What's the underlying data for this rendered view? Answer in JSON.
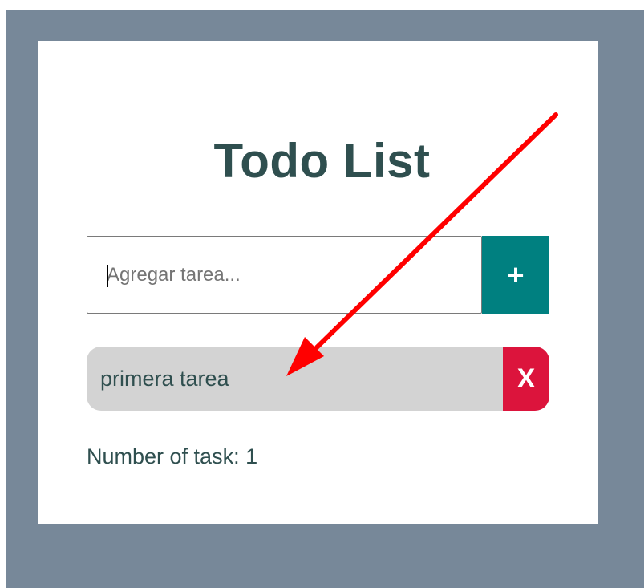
{
  "app": {
    "title": "Todo List"
  },
  "input": {
    "value": "",
    "placeholder": "Agregar tarea..."
  },
  "add_button": {
    "label": "+"
  },
  "tasks": [
    {
      "text": "primera tarea",
      "delete_label": "X"
    }
  ],
  "counter": {
    "text": "Number of task: 1"
  },
  "icons": {
    "annotation": "red-arrow-icon"
  },
  "colors": {
    "background": "#778899",
    "card": "#ffffff",
    "text": "#2f4f4f",
    "add_button": "#008080",
    "delete_button": "#dc143c",
    "task_item": "#d3d3d3",
    "annotation_arrow": "#ff0000"
  }
}
